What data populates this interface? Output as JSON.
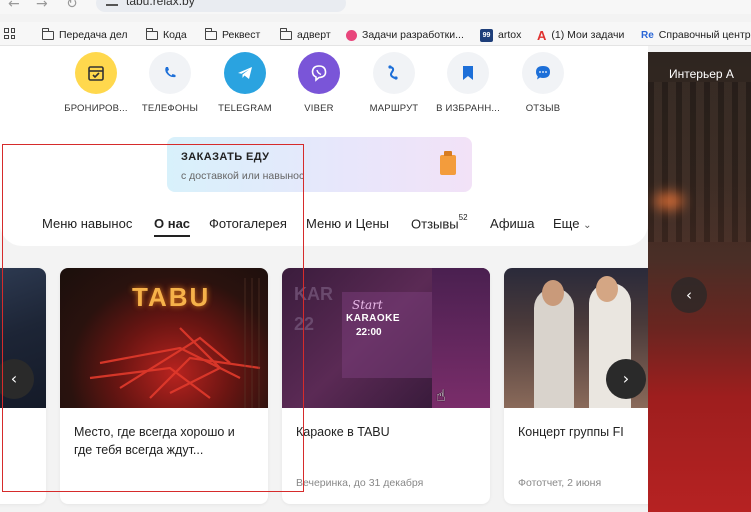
{
  "browser": {
    "url": "tabu.relax.by",
    "bookmarks": [
      {
        "label": "Передача дел",
        "icon": "folder-icon"
      },
      {
        "label": "Кода",
        "icon": "folder-icon"
      },
      {
        "label": "Реквест",
        "icon": "folder-icon"
      },
      {
        "label": "адверт",
        "icon": "folder-icon"
      },
      {
        "label": "Задачи разработки...",
        "icon": "app-icon"
      },
      {
        "label": "artox",
        "icon": "artox-icon"
      },
      {
        "label": "(1) Мои задачи",
        "icon": "tasks-icon"
      },
      {
        "label": "Справочный центр",
        "icon": "help-center-icon"
      }
    ]
  },
  "actions": [
    {
      "label": "БРОНИРОВ...",
      "icon": "calendar-icon",
      "color": "#ffd84d"
    },
    {
      "label": "ТЕЛЕФОНЫ",
      "icon": "phone-icon",
      "color": "#f1f3f6"
    },
    {
      "label": "TELEGRAM",
      "icon": "telegram-icon",
      "color": "#2aa3e0"
    },
    {
      "label": "VIBER",
      "icon": "viber-icon",
      "color": "#7a55d8"
    },
    {
      "label": "МАРШРУТ",
      "icon": "route-icon",
      "color": "#f1f3f6"
    },
    {
      "label": "В ИЗБРАНН...",
      "icon": "bookmark-icon",
      "color": "#f1f3f6"
    },
    {
      "label": "ОТЗЫВ",
      "icon": "chat-icon",
      "color": "#f1f3f6"
    }
  ],
  "order": {
    "title": "ЗАКАЗАТЬ ЕДУ",
    "subtitle": "с доставкой или навынос"
  },
  "tabs": [
    {
      "label": "Меню навынос",
      "active": false
    },
    {
      "label": "О нас",
      "active": true
    },
    {
      "label": "Фотогалерея",
      "active": false
    },
    {
      "label": "Меню и Цены",
      "active": false
    },
    {
      "label": "Отзывы",
      "count": "52",
      "active": false
    },
    {
      "label": "Афиша",
      "active": false
    },
    {
      "label": "Еще",
      "active": false
    }
  ],
  "cards": [
    {
      "title": "Место, где всегда хорошо и где тебя всегда ждут...",
      "meta": "",
      "image_text": "TABU"
    },
    {
      "title": "Караоке в TABU",
      "meta": "Вечеринка, до 31 декабря",
      "image_text_1": "Start",
      "image_text_2": "KARAOKE",
      "image_text_3": "22:00",
      "image_bg_text_1": "KAR",
      "image_bg_text_2": "22"
    },
    {
      "title": "Концерт группы FI",
      "meta": "Фототчет, 2 июня"
    }
  ],
  "side_panel": {
    "label": "Интерьер  А"
  },
  "colors": {
    "highlight_box": "#d62b2b",
    "accent_dark": "#222222"
  }
}
